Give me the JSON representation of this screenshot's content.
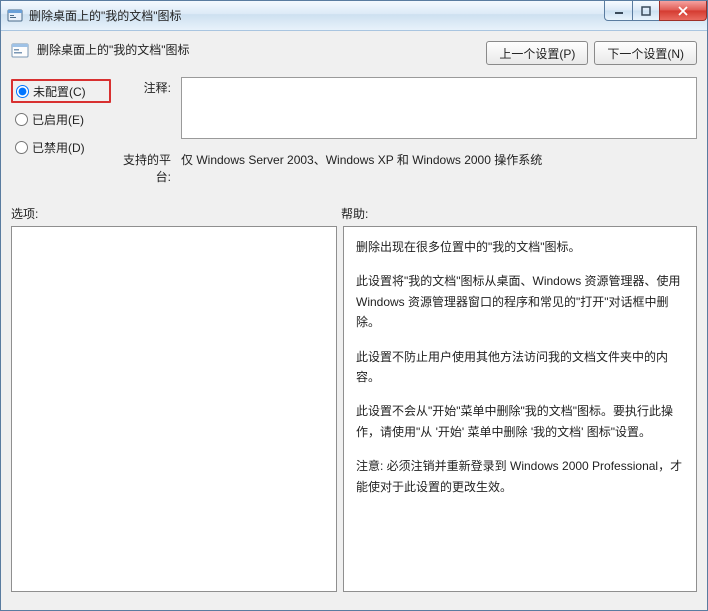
{
  "window": {
    "title": "删除桌面上的\"我的文档\"图标"
  },
  "header": {
    "title": "删除桌面上的\"我的文档\"图标",
    "prev_button": "上一个设置(P)",
    "next_button": "下一个设置(N)"
  },
  "radios": {
    "not_configured": "未配置(C)",
    "enabled": "已启用(E)",
    "disabled": "已禁用(D)",
    "selected": "not_configured"
  },
  "fields": {
    "comment_label": "注释:",
    "comment_value": "",
    "platform_label": "支持的平台:",
    "platform_value": "仅 Windows Server 2003、Windows XP 和 Windows 2000 操作系统"
  },
  "section_labels": {
    "options": "选项:",
    "help": "帮助:"
  },
  "help": {
    "p1": "删除出现在很多位置中的\"我的文档\"图标。",
    "p2": "此设置将\"我的文档\"图标从桌面、Windows 资源管理器、使用 Windows 资源管理器窗口的程序和常见的\"打开\"对话框中删除。",
    "p3": "此设置不防止用户使用其他方法访问我的文档文件夹中的内容。",
    "p4": "此设置不会从\"开始\"菜单中删除\"我的文档\"图标。要执行此操作，请使用\"从 '开始' 菜单中删除 '我的文档' 图标\"设置。",
    "p5": "注意: 必须注销并重新登录到 Windows 2000 Professional，才能使对于此设置的更改生效。"
  }
}
